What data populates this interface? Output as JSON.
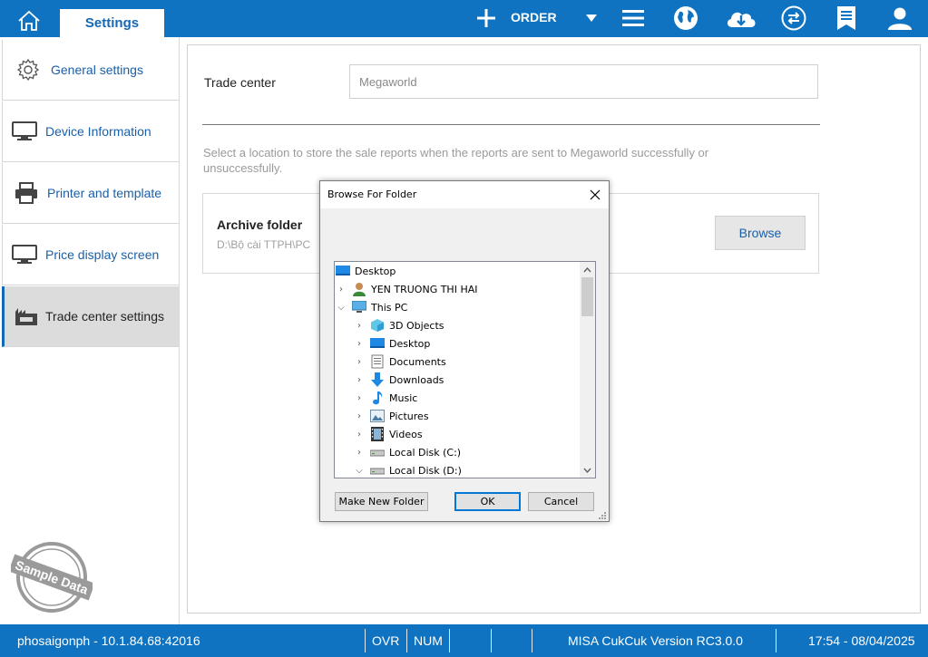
{
  "topbar": {
    "settings_tab": "Settings",
    "order_label": "ORDER",
    "icons": [
      "home-icon",
      "plus-icon",
      "dropdown-caret-icon",
      "menu-icon",
      "globe-icon",
      "cloud-download-icon",
      "sync-icon",
      "report-icon",
      "user-icon"
    ],
    "color": "#0f73c1"
  },
  "sidebar": {
    "items": [
      {
        "label": "General settings",
        "icon": "gear-icon"
      },
      {
        "label": "Device Information",
        "icon": "monitor-icon"
      },
      {
        "label": "Printer and template",
        "icon": "printer-icon"
      },
      {
        "label": "Price display screen",
        "icon": "monitor-icon"
      },
      {
        "label": "Trade center settings",
        "icon": "mall-icon",
        "active": true
      }
    ],
    "stamp": "Sample Data"
  },
  "main": {
    "trade_center_label": "Trade center",
    "trade_center_value": "Megaworld",
    "description": "Select a location to store the sale reports when the reports are sent to Megaworld successfully or unsuccessfully.",
    "archive_title": "Archive folder",
    "archive_path": "D:\\Bộ cài TTPH\\PC",
    "browse_label": "Browse"
  },
  "dialog": {
    "title": "Browse For Folder",
    "tree": [
      {
        "label": "Desktop",
        "icon": "desktop-icon",
        "level": 0,
        "chevron": ""
      },
      {
        "label": "YEN TRUONG THI HAI",
        "icon": "user-folder-icon",
        "level": 1,
        "chevron": ">"
      },
      {
        "label": "This PC",
        "icon": "computer-icon",
        "level": 1,
        "chevron": "v"
      },
      {
        "label": "3D Objects",
        "icon": "3d-objects-icon",
        "level": 2,
        "chevron": ">"
      },
      {
        "label": "Desktop",
        "icon": "desktop-icon",
        "level": 2,
        "chevron": ">"
      },
      {
        "label": "Documents",
        "icon": "documents-icon",
        "level": 2,
        "chevron": ">"
      },
      {
        "label": "Downloads",
        "icon": "downloads-icon",
        "level": 2,
        "chevron": ">"
      },
      {
        "label": "Music",
        "icon": "music-icon",
        "level": 2,
        "chevron": ">"
      },
      {
        "label": "Pictures",
        "icon": "pictures-icon",
        "level": 2,
        "chevron": ">"
      },
      {
        "label": "Videos",
        "icon": "videos-icon",
        "level": 2,
        "chevron": ">"
      },
      {
        "label": "Local Disk (C:)",
        "icon": "disk-icon",
        "level": 2,
        "chevron": ">"
      },
      {
        "label": "Local Disk (D:)",
        "icon": "disk-icon",
        "level": 2,
        "chevron": "v"
      }
    ],
    "make_new_folder": "Make New Folder",
    "ok": "OK",
    "cancel": "Cancel"
  },
  "statusbar": {
    "connection": "phosaigonph - 10.1.84.68:42016",
    "ovr": "OVR",
    "num": "NUM",
    "version": "MISA CukCuk Version RC3.0.0",
    "datetime": "17:54 - 08/04/2025"
  }
}
